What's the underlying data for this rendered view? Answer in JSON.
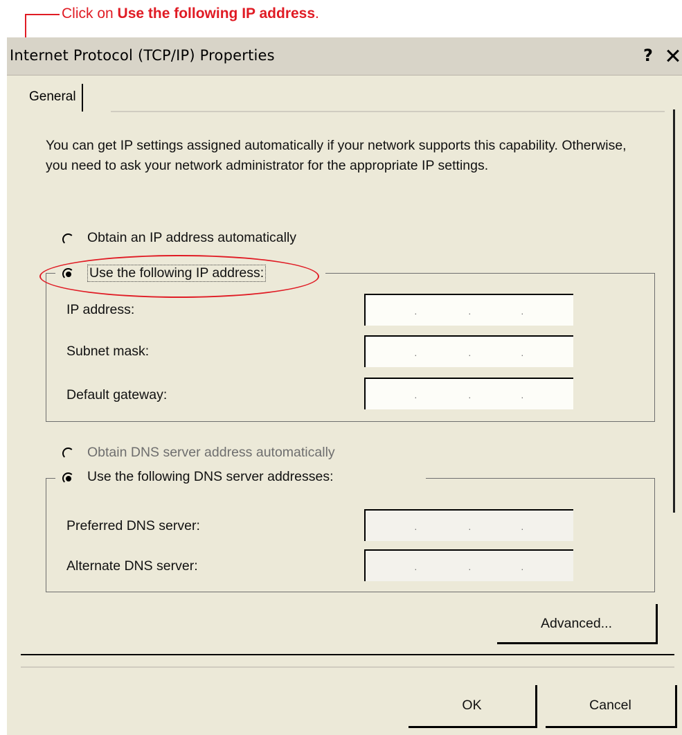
{
  "callout": {
    "prefix": "Click on ",
    "target": "Use the following IP address",
    "suffix": "."
  },
  "window": {
    "title": "Internet Protocol (TCP/IP) Properties",
    "help_label": "?",
    "close_label": "X"
  },
  "tabs": [
    {
      "label": "General",
      "selected": true
    }
  ],
  "description": "You can get IP settings assigned automatically if your network supports this capability. Otherwise, you need to ask your network administrator for the appropriate IP settings.",
  "ip_section": {
    "obtain_auto": {
      "label": "Obtain an IP address automatically",
      "selected": false
    },
    "use_following": {
      "label": "Use the following IP address:",
      "selected": true
    },
    "fields": [
      {
        "label": "IP address:",
        "value": ". . ."
      },
      {
        "label": "Subnet mask:",
        "value": ". . ."
      },
      {
        "label": "Default gateway:",
        "value": ". . ."
      }
    ]
  },
  "dns_section": {
    "obtain_auto": {
      "label": "Obtain DNS server address automatically",
      "selected": false,
      "disabled": true
    },
    "use_following": {
      "label": "Use the following DNS server addresses:",
      "selected": true
    },
    "fields": [
      {
        "label": "Preferred DNS server:",
        "value": ". . ."
      },
      {
        "label": "Alternate DNS server:",
        "value": ". . ."
      }
    ]
  },
  "buttons": {
    "advanced": "Advanced...",
    "ok": "OK",
    "cancel": "Cancel"
  },
  "colors": {
    "callout": "#e01b24",
    "dialog_bg": "#ece9d8",
    "titlebar_bg": "#d8d4c8"
  }
}
